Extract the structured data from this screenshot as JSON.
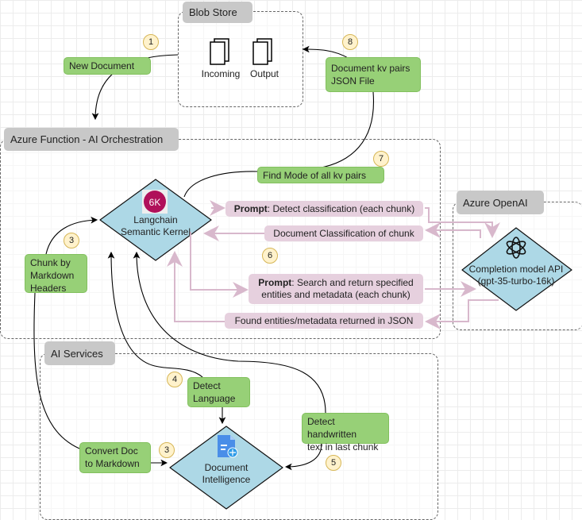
{
  "groups": {
    "blob_store": "Blob Store",
    "azure_function": "Azure Function - AI Orchestration",
    "azure_openai": "Azure OpenAI",
    "ai_services": "AI Services"
  },
  "blob": {
    "incoming": "Incoming",
    "output": "Output"
  },
  "steps": {
    "new_document": "New Document",
    "kv_json_line1": "Document kv pairs",
    "kv_json_line2": "JSON File",
    "find_mode": "Find Mode of all kv pairs",
    "chunk_line1": "Chunk by",
    "chunk_line2": "Markdown",
    "chunk_line3": "Headers",
    "detect_language_line1": "Detect",
    "detect_language_line2": "Language",
    "handwritten_line1": "Detect handwritten",
    "handwritten_line2": "text in last chunk",
    "convert_line1": "Convert Doc",
    "convert_line2": "to Markdown"
  },
  "messages": {
    "prompt_bold": "Prompt",
    "prompt_classify": ": Detect classification (each chunk)",
    "classification_result": "Document Classification of chunk",
    "prompt_search_line1": ": Search and return specified",
    "prompt_search_line2": "entities and metadata (each chunk)",
    "found_entities": "Found entities/metadata returned in JSON"
  },
  "nodes": {
    "kernel_line1": "Langchain",
    "kernel_line2": "Semantic Kernel",
    "openai_line1": "Completion model API",
    "openai_line2": "(gpt-35-turbo-16k)",
    "docintel_line1": "Document",
    "docintel_line2": "Intelligence",
    "kernel_logo": "6K"
  },
  "badges": {
    "b1": "1",
    "b3a": "3",
    "b3b": "3",
    "b4": "4",
    "b5": "5",
    "b6": "6",
    "b7": "7",
    "b8": "8"
  },
  "colors": {
    "step_green": "#97d077",
    "message_pink": "#e6d0de",
    "node_blue": "#add8e6",
    "badge": "#fff2cc",
    "group_label": "#c8c8c8"
  }
}
